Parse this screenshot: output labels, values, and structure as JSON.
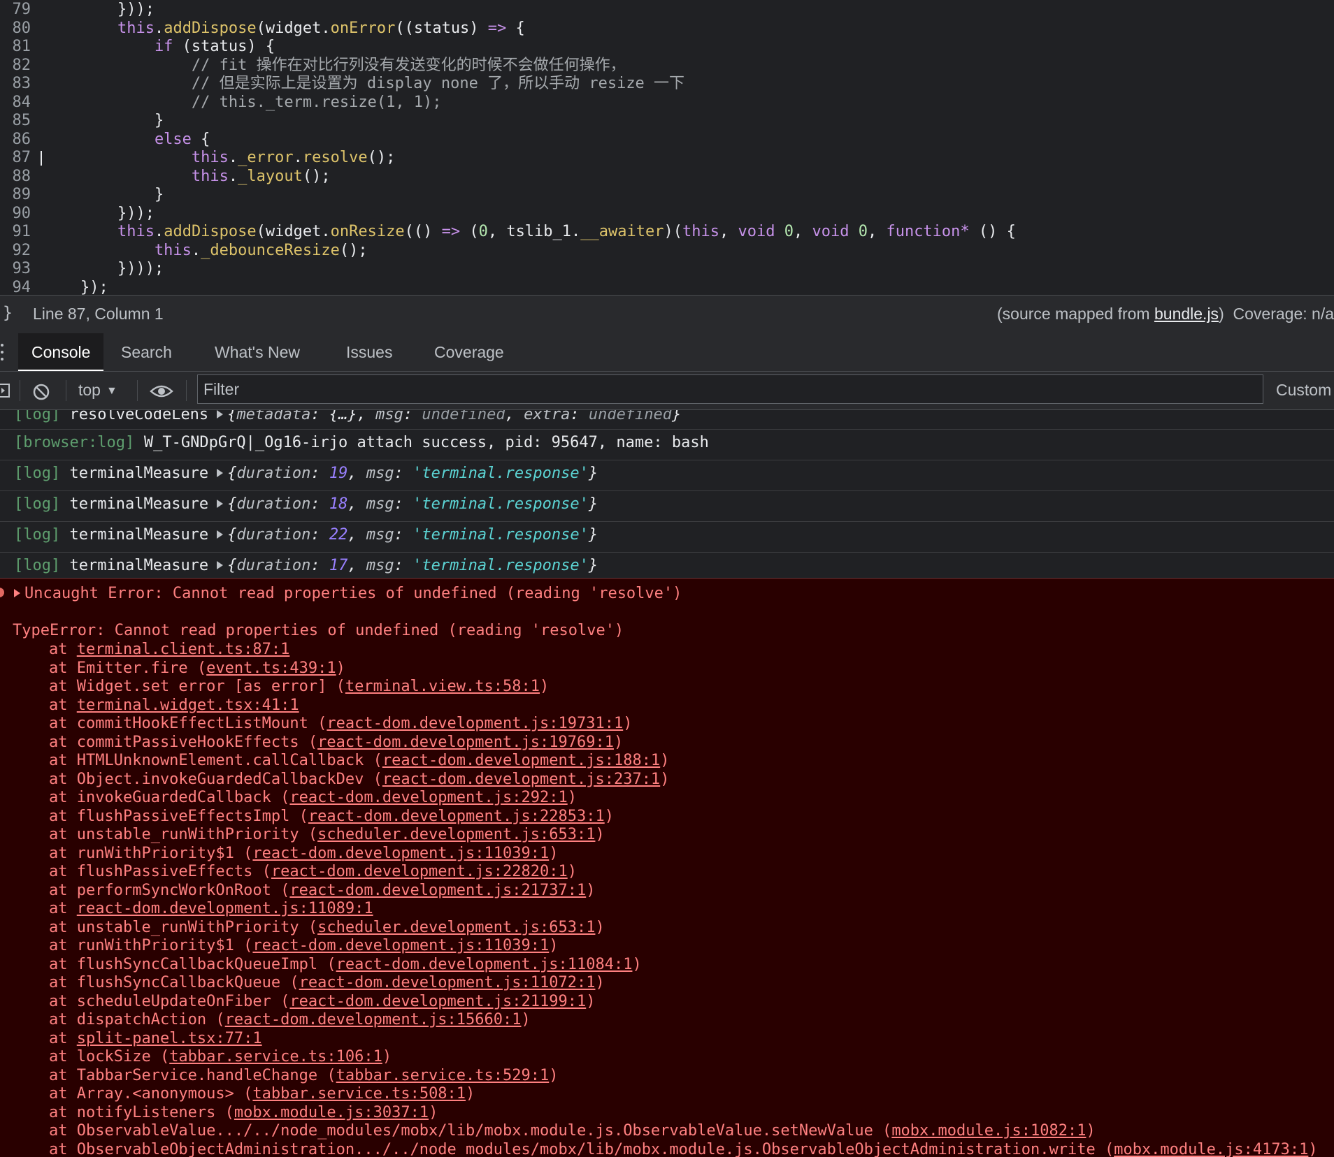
{
  "editor": {
    "lines": [
      {
        "n": "79",
        "segs": [
          [
            "pl",
            "        }));"
          ]
        ]
      },
      {
        "n": "80",
        "segs": [
          [
            "kw",
            "        this"
          ],
          [
            "pl",
            "."
          ],
          [
            "fn",
            "addDispose"
          ],
          [
            "pl",
            "(widget."
          ],
          [
            "fn",
            "onError"
          ],
          [
            "pl",
            "((status) "
          ],
          [
            "op",
            "=>"
          ],
          [
            "pl",
            " {"
          ]
        ]
      },
      {
        "n": "81",
        "segs": [
          [
            "kw",
            "            if"
          ],
          [
            "pl",
            " (status) {"
          ]
        ]
      },
      {
        "n": "82",
        "segs": [
          [
            "cm",
            "                // fit 操作在对比行列没有发送变化的时候不会做任何操作，"
          ]
        ]
      },
      {
        "n": "83",
        "segs": [
          [
            "cm",
            "                // 但是实际上是设置为 display none 了，所以手动 resize 一下"
          ]
        ]
      },
      {
        "n": "84",
        "segs": [
          [
            "cm",
            "                // this._term.resize(1, 1);"
          ]
        ]
      },
      {
        "n": "85",
        "segs": [
          [
            "pl",
            "            }"
          ]
        ]
      },
      {
        "n": "86",
        "segs": [
          [
            "kw",
            "            else"
          ],
          [
            "pl",
            " {"
          ]
        ]
      },
      {
        "n": "87",
        "segs": [
          [
            "kw",
            "                this"
          ],
          [
            "pl",
            "."
          ],
          [
            "fn",
            "_error"
          ],
          [
            "pl",
            "."
          ],
          [
            "fn",
            "resolve"
          ],
          [
            "pl",
            "();"
          ]
        ],
        "cursor": true
      },
      {
        "n": "88",
        "segs": [
          [
            "kw",
            "                this"
          ],
          [
            "pl",
            "."
          ],
          [
            "fn",
            "_layout"
          ],
          [
            "pl",
            "();"
          ]
        ]
      },
      {
        "n": "89",
        "segs": [
          [
            "pl",
            "            }"
          ]
        ]
      },
      {
        "n": "90",
        "segs": [
          [
            "pl",
            "        }));"
          ]
        ]
      },
      {
        "n": "91",
        "segs": [
          [
            "kw",
            "        this"
          ],
          [
            "pl",
            "."
          ],
          [
            "fn",
            "addDispose"
          ],
          [
            "pl",
            "(widget."
          ],
          [
            "fn",
            "onResize"
          ],
          [
            "pl",
            "(() "
          ],
          [
            "op",
            "=>"
          ],
          [
            "pl",
            " ("
          ],
          [
            "num",
            "0"
          ],
          [
            "pl",
            ", tslib_1."
          ],
          [
            "fn",
            "__awaiter"
          ],
          [
            "pl",
            ")("
          ],
          [
            "kw",
            "this"
          ],
          [
            "pl",
            ", "
          ],
          [
            "kw",
            "void"
          ],
          [
            "pl",
            " "
          ],
          [
            "num",
            "0"
          ],
          [
            "pl",
            ", "
          ],
          [
            "kw",
            "void"
          ],
          [
            "pl",
            " "
          ],
          [
            "num",
            "0"
          ],
          [
            "pl",
            ", "
          ],
          [
            "kw",
            "function*"
          ],
          [
            "pl",
            " () {"
          ]
        ]
      },
      {
        "n": "92",
        "segs": [
          [
            "kw",
            "            this"
          ],
          [
            "pl",
            "."
          ],
          [
            "fn",
            "_debounceResize"
          ],
          [
            "pl",
            "();"
          ]
        ]
      },
      {
        "n": "93",
        "segs": [
          [
            "pl",
            "        })));"
          ]
        ]
      },
      {
        "n": "94",
        "segs": [
          [
            "pl",
            "    });"
          ]
        ]
      }
    ]
  },
  "status_bar": {
    "brace": "}",
    "position": "Line 87, Column 1",
    "source_prefix": "(source mapped from ",
    "source_file": "bundle.js",
    "source_suffix": ")",
    "coverage": "Coverage: n/a"
  },
  "drawer": {
    "tabs": [
      {
        "label": "Console",
        "active": true
      },
      {
        "label": "Search",
        "active": false
      },
      {
        "label": "What's New",
        "active": false
      },
      {
        "label": "Issues",
        "active": false
      },
      {
        "label": "Coverage",
        "active": false
      }
    ]
  },
  "toolbar": {
    "context": "top",
    "filter_placeholder": "Filter",
    "custom_levels": "Custom"
  },
  "messages": [
    {
      "tag": "[log]",
      "text": "resolveCodeLens",
      "parts": [
        [
          "obj",
          "{"
        ],
        [
          "key",
          "metadata"
        ],
        [
          "obj",
          ": {…}, "
        ],
        [
          "key",
          "msg"
        ],
        [
          "obj",
          ": "
        ],
        [
          "valund",
          "undefined"
        ],
        [
          "obj",
          ", "
        ],
        [
          "key",
          "extra"
        ],
        [
          "obj",
          ": "
        ],
        [
          "valund",
          "undefined"
        ],
        [
          "obj",
          "}"
        ]
      ]
    },
    {
      "tag": "[browser:log]",
      "text": "W_T-GNDpGrQ|_Og16-irjo attach success, pid: 95647, name: bash",
      "parts": []
    },
    {
      "tag": "[log]",
      "text": "terminalMeasure",
      "parts": [
        [
          "obj",
          "{"
        ],
        [
          "key",
          "duration"
        ],
        [
          "obj",
          ": "
        ],
        [
          "valnum",
          "19"
        ],
        [
          "obj",
          ", "
        ],
        [
          "key",
          "msg"
        ],
        [
          "obj",
          ": "
        ],
        [
          "valstr",
          "'terminal.response'"
        ],
        [
          "obj",
          "}"
        ]
      ]
    },
    {
      "tag": "[log]",
      "text": "terminalMeasure",
      "parts": [
        [
          "obj",
          "{"
        ],
        [
          "key",
          "duration"
        ],
        [
          "obj",
          ": "
        ],
        [
          "valnum",
          "18"
        ],
        [
          "obj",
          ", "
        ],
        [
          "key",
          "msg"
        ],
        [
          "obj",
          ": "
        ],
        [
          "valstr",
          "'terminal.response'"
        ],
        [
          "obj",
          "}"
        ]
      ]
    },
    {
      "tag": "[log]",
      "text": "terminalMeasure",
      "parts": [
        [
          "obj",
          "{"
        ],
        [
          "key",
          "duration"
        ],
        [
          "obj",
          ": "
        ],
        [
          "valnum",
          "22"
        ],
        [
          "obj",
          ", "
        ],
        [
          "key",
          "msg"
        ],
        [
          "obj",
          ": "
        ],
        [
          "valstr",
          "'terminal.response'"
        ],
        [
          "obj",
          "}"
        ]
      ]
    },
    {
      "tag": "[log]",
      "text": "terminalMeasure",
      "parts": [
        [
          "obj",
          "{"
        ],
        [
          "key",
          "duration"
        ],
        [
          "obj",
          ": "
        ],
        [
          "valnum",
          "17"
        ],
        [
          "obj",
          ", "
        ],
        [
          "key",
          "msg"
        ],
        [
          "obj",
          ": "
        ],
        [
          "valstr",
          "'terminal.response'"
        ],
        [
          "obj",
          "}"
        ]
      ]
    }
  ],
  "error": {
    "summary": "Uncaught Error: Cannot read properties of undefined (reading 'resolve')",
    "type_line": "TypeError: Cannot read properties of undefined (reading 'resolve')",
    "frames": [
      {
        "fn": "",
        "loc": "terminal.client.ts:87:1"
      },
      {
        "fn": "Emitter.fire",
        "loc": "event.ts:439:1"
      },
      {
        "fn": "Widget.set error [as error]",
        "loc": "terminal.view.ts:58:1"
      },
      {
        "fn": "",
        "loc": "terminal.widget.tsx:41:1"
      },
      {
        "fn": "commitHookEffectListMount",
        "loc": "react-dom.development.js:19731:1"
      },
      {
        "fn": "commitPassiveHookEffects",
        "loc": "react-dom.development.js:19769:1"
      },
      {
        "fn": "HTMLUnknownElement.callCallback",
        "loc": "react-dom.development.js:188:1"
      },
      {
        "fn": "Object.invokeGuardedCallbackDev",
        "loc": "react-dom.development.js:237:1"
      },
      {
        "fn": "invokeGuardedCallback",
        "loc": "react-dom.development.js:292:1"
      },
      {
        "fn": "flushPassiveEffectsImpl",
        "loc": "react-dom.development.js:22853:1"
      },
      {
        "fn": "unstable_runWithPriority",
        "loc": "scheduler.development.js:653:1"
      },
      {
        "fn": "runWithPriority$1",
        "loc": "react-dom.development.js:11039:1"
      },
      {
        "fn": "flushPassiveEffects",
        "loc": "react-dom.development.js:22820:1"
      },
      {
        "fn": "performSyncWorkOnRoot",
        "loc": "react-dom.development.js:21737:1"
      },
      {
        "fn": "",
        "loc": "react-dom.development.js:11089:1"
      },
      {
        "fn": "unstable_runWithPriority",
        "loc": "scheduler.development.js:653:1"
      },
      {
        "fn": "runWithPriority$1",
        "loc": "react-dom.development.js:11039:1"
      },
      {
        "fn": "flushSyncCallbackQueueImpl",
        "loc": "react-dom.development.js:11084:1"
      },
      {
        "fn": "flushSyncCallbackQueue",
        "loc": "react-dom.development.js:11072:1"
      },
      {
        "fn": "scheduleUpdateOnFiber",
        "loc": "react-dom.development.js:21199:1"
      },
      {
        "fn": "dispatchAction",
        "loc": "react-dom.development.js:15660:1"
      },
      {
        "fn": "",
        "loc": "split-panel.tsx:77:1"
      },
      {
        "fn": "lockSize",
        "loc": "tabbar.service.ts:106:1"
      },
      {
        "fn": "TabbarService.handleChange",
        "loc": "tabbar.service.ts:529:1"
      },
      {
        "fn": "Array.<anonymous>",
        "loc": "tabbar.service.ts:508:1"
      },
      {
        "fn": "notifyListeners",
        "loc": "mobx.module.js:3037:1"
      },
      {
        "fn": "ObservableValue.../../node_modules/mobx/lib/mobx.module.js.ObservableValue.setNewValue",
        "loc": "mobx.module.js:1082:1"
      },
      {
        "fn": "ObservableObjectAdministration.../../node_modules/mobx/lib/mobx.module.js.ObservableObjectAdministration.write",
        "loc": "mobx.module.js:4173:1"
      }
    ]
  },
  "colors": {
    "editor_bg": "#202124",
    "error_bg": "#290000",
    "error_text": "#ff8080",
    "log_tag": "#5e9e6e",
    "keyword": "#c792ea",
    "function": "#ddc36a"
  },
  "icons": {
    "sidebar_toggle": "sidebar-toggle-icon",
    "clear": "clear-console-icon",
    "live_expression": "eye-icon",
    "more": "kebab-menu-icon"
  }
}
